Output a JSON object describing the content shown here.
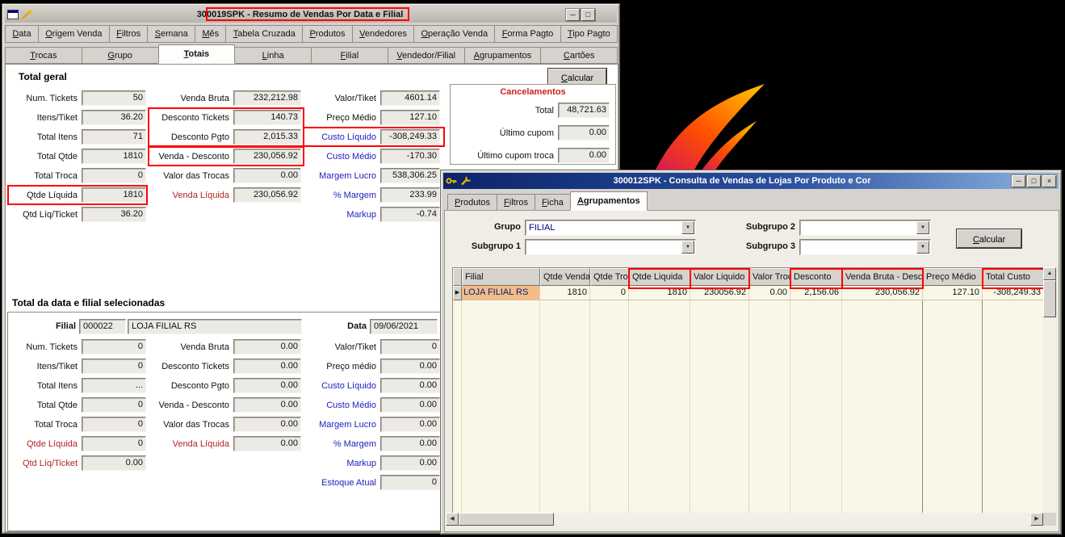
{
  "colors": {
    "annotation": "#ff0000",
    "active_titlebar": "#0a246a",
    "grid_highlight": "#f3bd85",
    "flame_gradient": [
      "#d4145a",
      "#ff4e00",
      "#ffc800"
    ]
  },
  "window1": {
    "title": "300019SPK - Resumo de Vendas Por Data e Filial",
    "titlebar_icons": [
      "form-icon",
      "tools-icon"
    ],
    "buttons": [
      {
        "name": "minimize",
        "glyph": "─"
      },
      {
        "name": "maximize",
        "glyph": "□"
      }
    ],
    "menu_tabs": [
      "Data",
      "Origem Venda",
      "Filtros",
      "Semana",
      "Mês",
      "Tabela Cruzada",
      "Produtos",
      "Vendedores",
      "Operação Venda",
      "Forma Pagto",
      "Tipo Pagto"
    ],
    "view_tabs": [
      "Trocas",
      "Grupo",
      "Totais",
      "Linha",
      "Filial",
      "Vendedor/Filial",
      "Agrupamentos",
      "Cartões"
    ],
    "active_view_tab": "Totais",
    "calcular_button": "Calcular",
    "total_geral": {
      "heading": "Total geral",
      "col1": [
        {
          "label": "Num. Tickets",
          "value": "50"
        },
        {
          "label": "Itens/Tiket",
          "value": "36.20"
        },
        {
          "label": "Total Itens",
          "value": "71"
        },
        {
          "label": "Total Qtde",
          "value": "1810"
        },
        {
          "label": "Total Troca",
          "value": "0"
        },
        {
          "label": "Qtde Líquida",
          "value": "1810"
        },
        {
          "label": "Qtd Líq/Ticket",
          "value": "36.20"
        }
      ],
      "col2": [
        {
          "label": "Venda Bruta",
          "value": "232,212.98"
        },
        {
          "label": "Desconto Tickets",
          "value": "140.73"
        },
        {
          "label": "Desconto Pgto",
          "value": "2,015.33"
        },
        {
          "label": "Venda - Desconto",
          "value": "230,056.92"
        },
        {
          "label": "Valor das Trocas",
          "value": "0.00"
        },
        {
          "label": "Venda Líquida",
          "value": "230,056.92",
          "lc": "red"
        }
      ],
      "col3": [
        {
          "label": "Valor/Tiket",
          "value": "4601.14"
        },
        {
          "label": "Preço Médio",
          "value": "127.10"
        },
        {
          "label": "Custo Líquido",
          "value": "-308,249.33",
          "lc": "blue"
        },
        {
          "label": "Custo Médio",
          "value": "-170.30",
          "lc": "blue"
        },
        {
          "label": "Margem Lucro",
          "value": "538,306.25",
          "lc": "blue"
        },
        {
          "label": "% Margem",
          "value": "233.99",
          "lc": "blue"
        },
        {
          "label": "Markup",
          "value": "-0.74",
          "lc": "blue"
        }
      ],
      "cancelamentos": {
        "heading": "Cancelamentos",
        "fields": [
          {
            "label": "Total",
            "value": "48,721.63"
          },
          {
            "label": "Último cupom",
            "value": "0.00"
          },
          {
            "label": "Último cupom troca",
            "value": "0.00"
          }
        ]
      }
    },
    "total_data_filial": {
      "heading": "Total da data e filial selecionadas",
      "filial_label": "Filial",
      "filial_code": "000022",
      "filial_name": "LOJA FILIAL RS",
      "data_label": "Data",
      "data_value": "09/06/2021",
      "col1": [
        {
          "label": "Num. Tickets",
          "value": "0"
        },
        {
          "label": "Itens/Tiket",
          "value": "0"
        },
        {
          "label": "Total Itens",
          "value": "..."
        },
        {
          "label": "Total Qtde",
          "value": "0"
        },
        {
          "label": "Total Troca",
          "value": "0"
        },
        {
          "label": "Qtde Líquida",
          "value": "0",
          "lc": "red"
        },
        {
          "label": "Qtd Líq/Ticket",
          "value": "0.00",
          "lc": "red"
        }
      ],
      "col2": [
        {
          "label": "Venda Bruta",
          "value": "0.00"
        },
        {
          "label": "Desconto Tickets",
          "value": "0.00"
        },
        {
          "label": "Desconto Pgto",
          "value": "0.00"
        },
        {
          "label": "Venda - Desconto",
          "value": "0.00"
        },
        {
          "label": "Valor das Trocas",
          "value": "0.00"
        },
        {
          "label": "Venda Líquida",
          "value": "0.00",
          "lc": "red"
        }
      ],
      "col3": [
        {
          "label": "Valor/Tiket",
          "value": "0"
        },
        {
          "label": "Preço médio",
          "value": "0.00"
        },
        {
          "label": "Custo Líquido",
          "value": "0.00",
          "lc": "blue"
        },
        {
          "label": "Custo Médio",
          "value": "0.00",
          "lc": "blue"
        },
        {
          "label": "Margem Lucro",
          "value": "0.00",
          "lc": "blue"
        },
        {
          "label": "% Margem",
          "value": "0.00",
          "lc": "blue"
        },
        {
          "label": "Markup",
          "value": "0.00",
          "lc": "blue"
        },
        {
          "label": "Estoque Atual",
          "value": "0",
          "lc": "blue"
        }
      ]
    }
  },
  "window2": {
    "title": "300012SPK - Consulta de Vendas de Lojas Por Produto e Cor",
    "titlebar_icons": [
      "key-icon",
      "wrench-icon"
    ],
    "buttons": [
      {
        "name": "minimize",
        "glyph": "─"
      },
      {
        "name": "maximize",
        "glyph": "□"
      },
      {
        "name": "close",
        "glyph": "×"
      }
    ],
    "tabs": [
      "Produtos",
      "Filtros",
      "Ficha",
      "Agrupamentos"
    ],
    "active_tab": "Agrupamentos",
    "controls": {
      "grupo_label": "Grupo",
      "grupo_value": "FILIAL",
      "subgrupo1_label": "Subgrupo 1",
      "subgrupo1_value": "",
      "subgrupo2_label": "Subgrupo 2",
      "subgrupo2_value": "",
      "subgrupo3_label": "Subgrupo 3",
      "subgrupo3_value": "",
      "dropdown_arrow": "▼",
      "calcular_button": "Calcular"
    },
    "grid": {
      "columns": [
        "Filial",
        "Qtde Venda",
        "Qtde Troca",
        "Qtde Liquida",
        "Valor Liquido",
        "Valor Troca",
        "Desconto",
        "Venda Bruta - Desc.",
        "Preço Médio",
        "Total Custo"
      ],
      "highlighted_columns": [
        "Qtde Liquida",
        "Valor Liquido",
        "Desconto",
        "Venda Bruta - Desc.",
        "Total Custo"
      ],
      "row_marker": "▶",
      "rows": [
        [
          "LOJA FILIAL RS",
          "1810",
          "0",
          "1810",
          "230056.92",
          "0.00",
          "2,156.06",
          "230,056.92",
          "127.10",
          "-308,249.33"
        ]
      ]
    },
    "scroll_glyphs": {
      "left": "◀",
      "right": "▶",
      "up": "▲",
      "down": "▼"
    }
  }
}
